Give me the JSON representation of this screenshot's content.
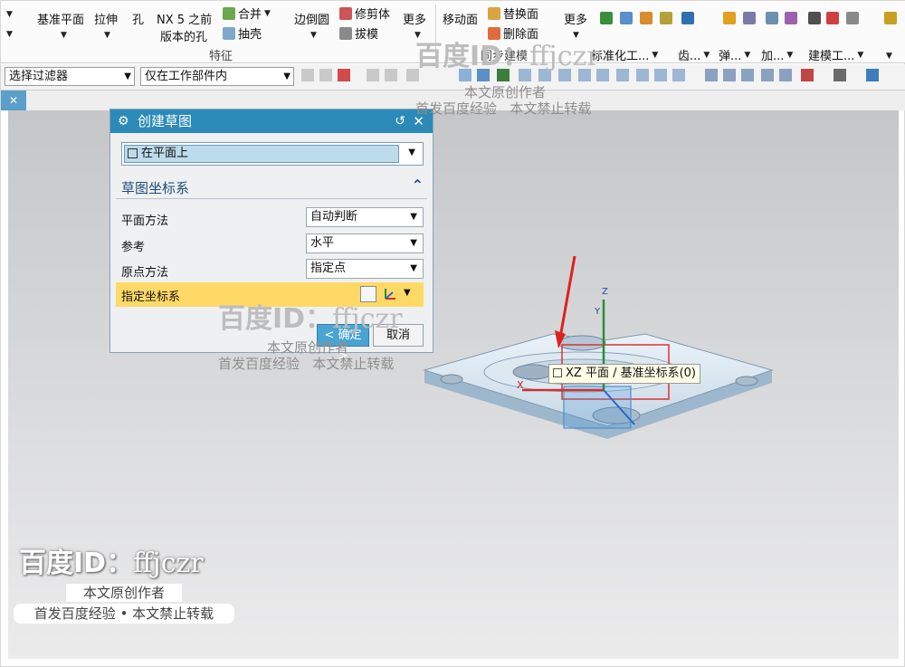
{
  "ribbon": {
    "buttons": [
      {
        "label": "基准平面"
      },
      {
        "label": "拉伸"
      },
      {
        "label": "孔"
      },
      {
        "label": "NX 5 之前"
      },
      {
        "label": "版本的孔"
      },
      {
        "label": "合并"
      },
      {
        "label": "抽壳"
      },
      {
        "label": "边倒圆"
      },
      {
        "label": "修剪体"
      },
      {
        "label": "拔模"
      },
      {
        "label": "更多"
      },
      {
        "label": "移动面"
      },
      {
        "label": "替换面"
      },
      {
        "label": "删除面"
      },
      {
        "label": "更多"
      }
    ],
    "group_feature": "特征",
    "group_sync": "同步建模",
    "tabs": [
      {
        "label": "标准化工..."
      },
      {
        "label": "齿..."
      },
      {
        "label": "弹..."
      },
      {
        "label": "加..."
      },
      {
        "label": "建模工..."
      }
    ]
  },
  "filterbar": {
    "filter": "选择过滤器",
    "scope": "仅在工作部件内"
  },
  "dialog": {
    "title": "创建草图",
    "type_value": "在平面上",
    "section_title": "草图坐标系",
    "rows": [
      {
        "label": "平面方法",
        "value": "自动判断"
      },
      {
        "label": "参考",
        "value": "水平"
      },
      {
        "label": "原点方法",
        "value": "指定点"
      },
      {
        "label": "指定坐标系"
      }
    ],
    "ok": "< 确定 >",
    "cancel": "取消"
  },
  "tooltip": "XZ 平面 / 基准坐标系(0)",
  "axes": {
    "x": "X",
    "y": "Y",
    "z": "Z"
  },
  "watermark": {
    "id_text": "百度ID：",
    "id_name": "ffjczr",
    "line1": "本文原创作者",
    "line2": "首发百度经验",
    "line3": "本文禁止转载",
    "badge_line2": "首发百度经验 • 本文禁止转载"
  },
  "colors": {
    "title_bar": "#2b8ab8",
    "highlight_row": "#ffd966",
    "ok_button": "#4aa4d2",
    "model": "#d8e4ee",
    "annotation_arrow": "#e02020"
  }
}
